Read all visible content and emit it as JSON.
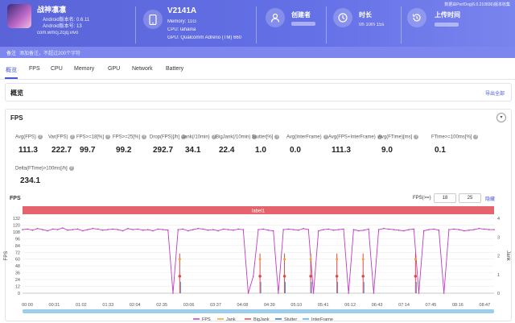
{
  "header": {
    "app_name": "战神凛凛",
    "android_ver1": "Android版本名: 0.6.11",
    "android_ver2": "Android版本号: 13",
    "package": "com.wmcj.zcjq.vivo",
    "device_name": "V2141A",
    "memory": "Memory: 11G",
    "cpu": "CPU: lahaina",
    "gpu": "GPU: Qualcomm Adreno (TM) 660",
    "creator_label": "创建者",
    "duration_label": "时长",
    "duration_value": "0h 10m 15s",
    "upload_label": "上传时间",
    "corner_text": "数据由PerfDog(6.0.210836)版本收集"
  },
  "note": {
    "label": "备注",
    "text": "添加备注，不超过200个字符"
  },
  "tabs": [
    "概览",
    "FPS",
    "CPU",
    "Memory",
    "GPU",
    "Network",
    "Battery"
  ],
  "overview": {
    "title": "概览",
    "export": "导出全部"
  },
  "fps_section": {
    "title": "FPS"
  },
  "metrics": [
    {
      "label": "Avg(FPS)",
      "value": "111.3"
    },
    {
      "label": "Var(FPS)",
      "value": "222.7"
    },
    {
      "label": "FPS>=18[%]",
      "value": "99.7"
    },
    {
      "label": "FPS>=25[%]",
      "value": "99.2"
    },
    {
      "label": "Drop(FPS)[/h]",
      "value": "292.7"
    },
    {
      "label": "Jank(/10min)",
      "value": "34.1"
    },
    {
      "label": "BigJank(/10min)",
      "value": "22.4"
    },
    {
      "label": "Stutter[%]",
      "value": "1.0"
    },
    {
      "label": "Avg(InterFrame)",
      "value": "0.0"
    },
    {
      "label": "Avg(FPS+InterFrame)",
      "value": "111.3"
    },
    {
      "label": "Avg(FTime)[ms]",
      "value": "9.0"
    },
    {
      "label": "FTime>=100ms[%]",
      "value": "0.1"
    },
    {
      "label": "Delta(FTime)>100ms[/h]",
      "value": "234.1"
    }
  ],
  "fps_chart_header": {
    "title": "FPS",
    "range_label": "FPS(>=)",
    "min": "18",
    "max": "25",
    "hide": "隐藏"
  },
  "chart_data": {
    "type": "line",
    "band_label": "label1",
    "ylabel_left": "FPS",
    "ylabel_right": "Jank",
    "ylim": [
      0,
      132
    ],
    "yticks": [
      0,
      12,
      24,
      36,
      48,
      60,
      72,
      84,
      96,
      108,
      120,
      132
    ],
    "y2lim": [
      0,
      4
    ],
    "y2ticks": [
      0,
      1,
      2,
      3,
      4
    ],
    "x": [
      "00:00",
      "00:31",
      "01:02",
      "01:33",
      "02:04",
      "02:35",
      "03:06",
      "03:37",
      "04:08",
      "04:39",
      "05:10",
      "05:41",
      "06:12",
      "06:43",
      "07:14",
      "07:45",
      "08:16",
      "08:47"
    ],
    "fps_series": [
      112,
      113,
      111,
      114,
      112,
      110,
      113,
      112,
      115,
      111,
      112,
      113,
      110,
      112,
      114,
      113,
      111,
      112,
      113,
      112,
      110,
      114,
      112,
      113,
      111,
      112,
      110,
      113,
      112,
      111,
      0,
      112,
      113,
      110,
      112,
      114,
      113,
      111,
      112,
      110,
      113,
      112,
      111,
      113,
      112,
      0,
      30,
      112,
      113,
      111,
      110,
      0,
      112,
      113,
      112,
      111,
      114,
      112,
      0,
      110,
      112,
      113,
      111,
      112,
      113,
      0,
      112,
      110,
      111,
      113,
      0,
      112,
      114,
      113,
      112,
      111,
      110,
      112,
      113,
      0,
      110,
      112,
      113,
      111,
      0,
      112,
      113,
      112,
      110,
      111,
      112,
      114,
      113,
      112,
      112
    ],
    "jank_markers": [
      3.06,
      4.41,
      5.1,
      5.41,
      6.12,
      6.43,
      7.45
    ],
    "legend": [
      "FPS",
      "Jank",
      "BigJank",
      "Stutter",
      "InterFrame"
    ],
    "colors": {
      "FPS": "#c03ac4",
      "Jank": "#f2a035",
      "BigJank": "#e24848",
      "Stutter": "#3a6fd8",
      "InterFrame": "#47b8e6",
      "band": "#e5636d"
    }
  }
}
